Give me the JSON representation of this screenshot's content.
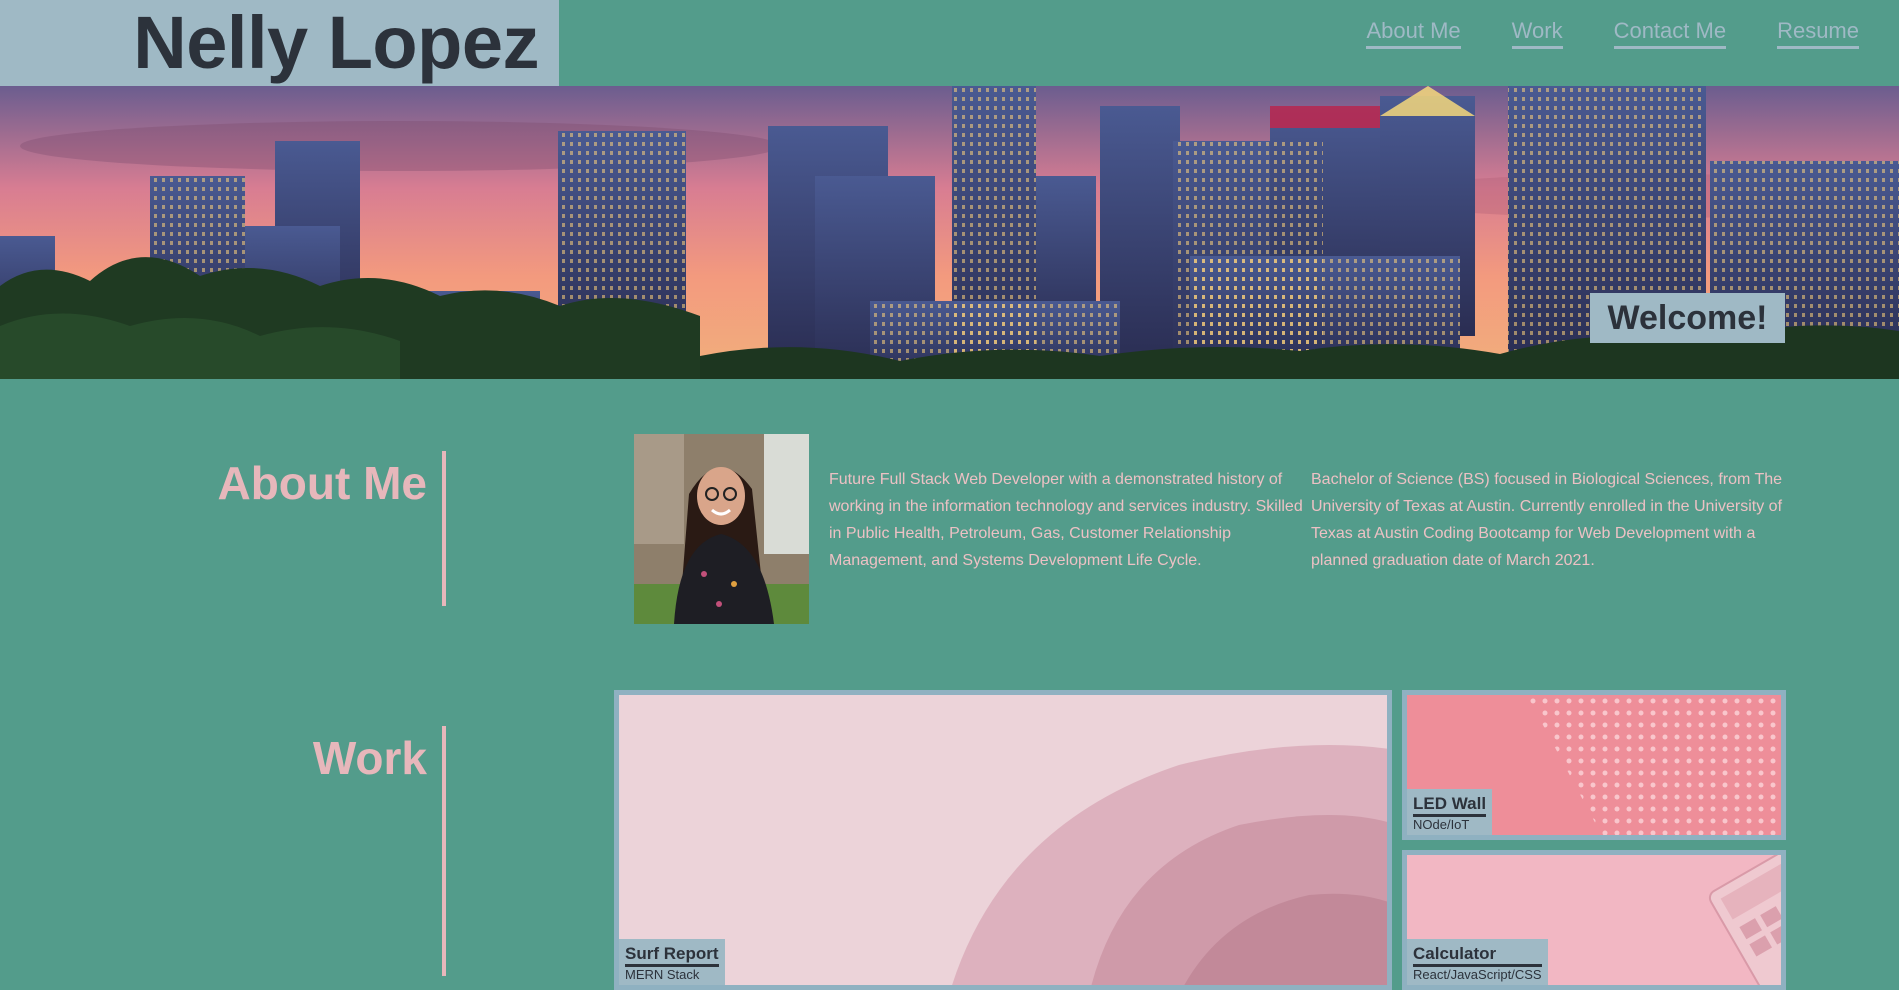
{
  "header": {
    "site_name": "Nelly Lopez",
    "nav": [
      "About Me",
      "Work",
      "Contact Me",
      "Resume"
    ]
  },
  "hero": {
    "welcome": "Welcome!"
  },
  "about": {
    "title": "About Me",
    "paragraph1": "Future Full Stack Web Developer with a demonstrated history of working in the information technology and services industry. Skilled in Public Health, Petroleum, Gas, Customer Relationship Management, and Systems Development Life Cycle.",
    "paragraph2": "Bachelor of Science (BS) focused in Biological Sciences, from The University of Texas at Austin. Currently enrolled in the University of Texas at Austin Coding Bootcamp for Web Development with a planned graduation date of March 2021."
  },
  "work": {
    "title": "Work",
    "projects": [
      {
        "title": "Surf Report",
        "subtitle": "MERN Stack"
      },
      {
        "title": "LED Wall",
        "subtitle": "NOde/IoT"
      },
      {
        "title": "Calculator",
        "subtitle": "React/JavaScript/CSS"
      }
    ]
  },
  "colors": {
    "background": "#539c8b",
    "header_box": "#9fb9c5",
    "dark_text": "#2c323b",
    "accent_pink": "#e7b7bb"
  }
}
